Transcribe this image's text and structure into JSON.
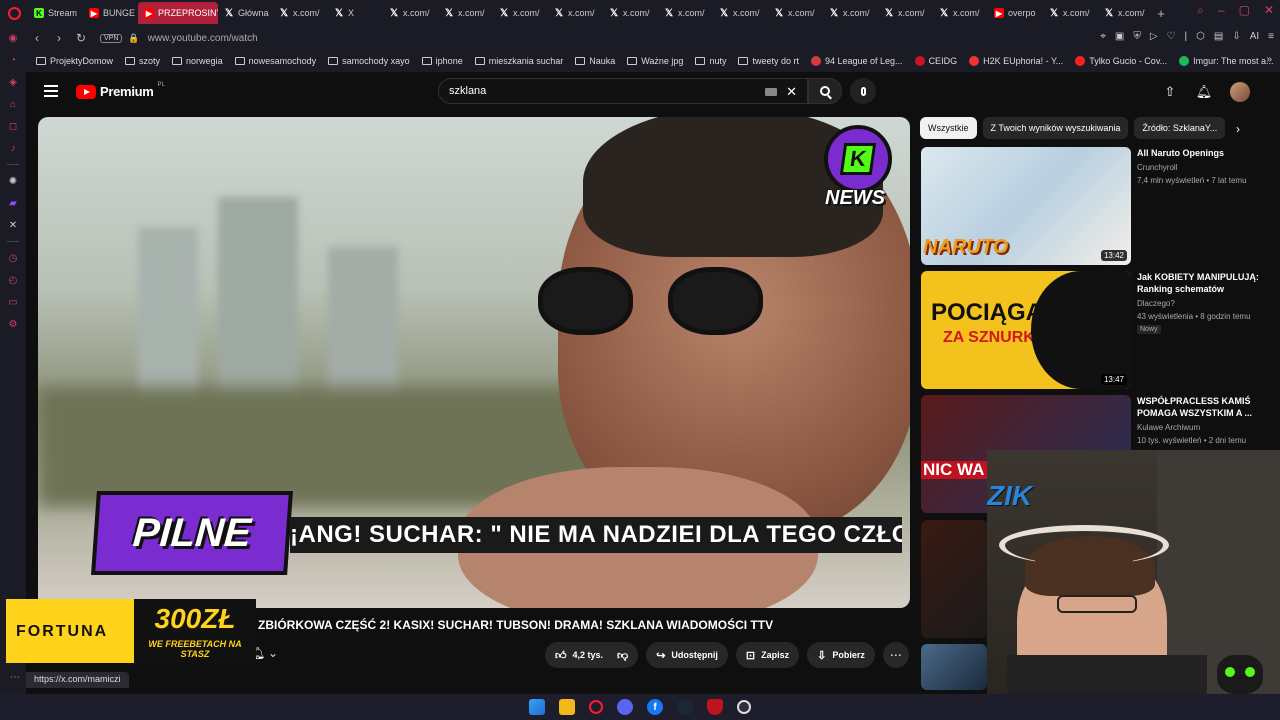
{
  "browser": {
    "tabs": [
      {
        "label": "Stream",
        "icon": "kick-icon",
        "active": false
      },
      {
        "label": "BUNGE",
        "icon": "youtube-icon",
        "active": false
      },
      {
        "label": "PRZEPROSINY",
        "icon": "youtube-icon",
        "active": true
      },
      {
        "label": "Główna",
        "icon": "x-icon",
        "active": false
      },
      {
        "label": "x.com/",
        "icon": "x-icon",
        "active": false
      },
      {
        "label": "X",
        "icon": "x-icon",
        "active": false
      },
      {
        "label": "x.com/",
        "icon": "x-icon",
        "active": false
      },
      {
        "label": "x.com/",
        "icon": "x-icon",
        "active": false
      },
      {
        "label": "x.com/",
        "icon": "x-icon",
        "active": false
      },
      {
        "label": "x.com/",
        "icon": "x-icon",
        "active": false
      },
      {
        "label": "x.com/",
        "icon": "x-icon",
        "active": false
      },
      {
        "label": "x.com/",
        "icon": "x-icon",
        "active": false
      },
      {
        "label": "x.com/",
        "icon": "x-icon",
        "active": false
      },
      {
        "label": "x.com/",
        "icon": "x-icon",
        "active": false
      },
      {
        "label": "x.com/",
        "icon": "x-icon",
        "active": false
      },
      {
        "label": "x.com/",
        "icon": "x-icon",
        "active": false
      },
      {
        "label": "x.com/",
        "icon": "x-icon",
        "active": false
      },
      {
        "label": "overpo",
        "icon": "youtube-icon",
        "active": false
      },
      {
        "label": "x.com/",
        "icon": "x-icon",
        "active": false
      },
      {
        "label": "x.com/",
        "icon": "x-icon",
        "active": false
      }
    ],
    "vpn_label": "VPN",
    "url": "www.youtube.com/watch",
    "bookmarks": [
      {
        "label": "ProjektyDomow",
        "type": "folder"
      },
      {
        "label": "szoty",
        "type": "folder"
      },
      {
        "label": "norwegia",
        "type": "folder"
      },
      {
        "label": "nowesamochody",
        "type": "folder"
      },
      {
        "label": "samochody xayo",
        "type": "folder"
      },
      {
        "label": "iphone",
        "type": "folder"
      },
      {
        "label": "mieszkania suchar",
        "type": "folder"
      },
      {
        "label": "Nauka",
        "type": "folder"
      },
      {
        "label": "Ważne jpg",
        "type": "folder"
      },
      {
        "label": "nuty",
        "type": "folder"
      },
      {
        "label": "tweety do rt",
        "type": "folder"
      },
      {
        "label": "94 League of Leg...",
        "type": "site"
      },
      {
        "label": "CEIDG",
        "type": "site"
      },
      {
        "label": "H2K EUphoria! - Y...",
        "type": "site"
      },
      {
        "label": "Tylko Gucio - Cov...",
        "type": "site"
      },
      {
        "label": "Imgur: The most a...",
        "type": "site"
      }
    ],
    "status_url": "https://x.com/mamiczi"
  },
  "youtube": {
    "brand": "Premium",
    "brand_sup": "PL",
    "search_value": "szklana",
    "video": {
      "pilne_label": "PILNE",
      "ticker_text": "¡ANG! SUCHAR: \" NIE MA NADZIEI DLA TEGO CZŁO",
      "news_label": "NEWS",
      "title": "ZBIÓRKOWA CZĘŚĆ 2! KASIX! SUCHAR! TUBSON! DRAMA! SZKLANA WIADOMOŚCI TTV",
      "likes": "4,2 tys.",
      "share_label": "Udostępnij",
      "save_label": "Zapisz",
      "download_label": "Pobierz"
    },
    "chips": [
      "Wszystkie",
      "Z Twoich wyników wyszukiwania",
      "Źródło: SzklanaY..."
    ],
    "recommendations": [
      {
        "title": "All Naruto Openings",
        "channel": "Crunchyroll",
        "meta": "7,4 mln wyświetleń • 7 lat temu",
        "duration": "13:42",
        "badge": "",
        "thumb_text": "NARUTO"
      },
      {
        "title": "Jak KOBIETY MANIPULUJĄ: Ranking schematów",
        "channel": "Dlaczego?",
        "meta": "43 wyświetlenia • 8 godzin temu",
        "duration": "13:47",
        "badge": "Nowy",
        "thumb_text_1": "POCIĄGA",
        "thumb_text_2": "ZA SZNURKI"
      },
      {
        "title": "WSPÓŁPRACLESS KAMIŚ POMAGA WSZYSTKIM A ...",
        "channel": "Kulawe Archiwum",
        "meta": "10 tys. wyświetleń • 2 dni temu",
        "duration": "",
        "badge": "",
        "thumb_text": "NIC WA NIE ZR"
      }
    ]
  },
  "overlay": {
    "fortuna_brand": "FORTUNA",
    "fortuna_amount": "300ZŁ",
    "fortuna_tagline": "WE FREEBETACH NA STASZ",
    "cam_logo": "ZIK"
  },
  "colors": {
    "opera_red": "#ff1b2d",
    "yt_red": "#ff0000",
    "kick_green": "#53fc18",
    "purple": "#7b2cd1",
    "fortuna_yellow": "#ffd21c"
  }
}
